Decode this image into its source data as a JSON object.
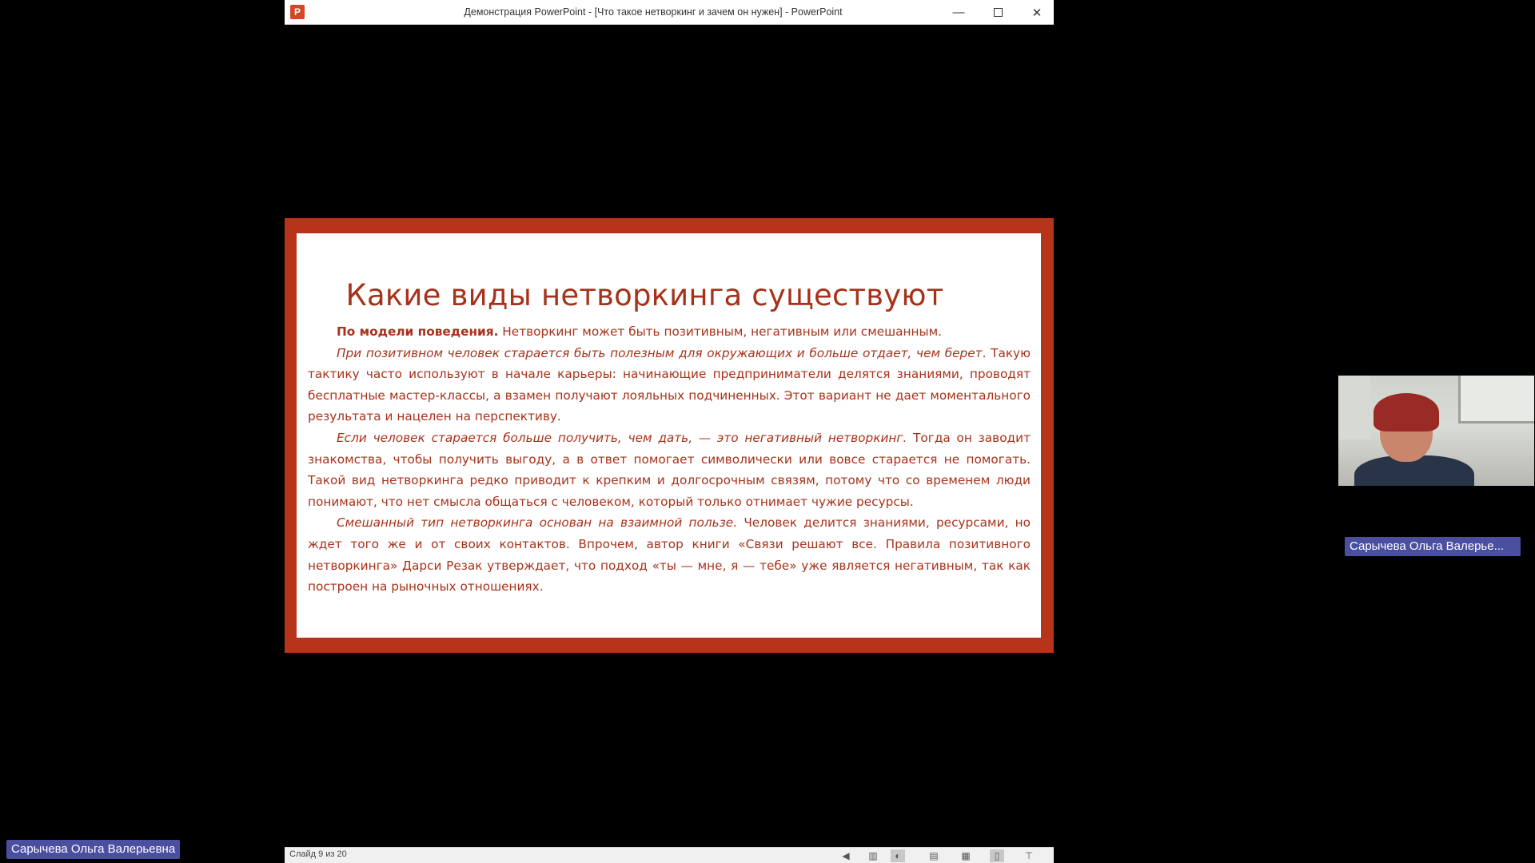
{
  "window": {
    "app_icon": "P",
    "title": "Демонстрация PowerPoint - [Что такое нетворкинг и зачем он нужен] - PowerPoint",
    "min_glyph": "—",
    "close_glyph": "✕"
  },
  "slide": {
    "title": "Какие виды нетворкинга существуют",
    "p1_bold": "По модели поведения.",
    "p1_text": " Нетворкинг может быть позитивным, негативным или смешанным.",
    "p2_italic": "При позитивном человек старается быть полезным для окружающих и больше отдает, чем берет",
    "p2_text": ". Такую тактику часто используют в начале карьеры: начинающие предприниматели делятся знаниями, проводят бесплатные мастер-классы, а взамен получают лояльных подчиненных. Этот вариант не дает моментального результата и нацелен на перспективу.",
    "p3_italic": "Если человек старается больше получить, чем дать, — это негативный нетворкинг.",
    "p3_text": " Тогда он заводит знакомства, чтобы получить выгоду, а в ответ помогает символически или вовсе старается не помогать. Такой вид нетворкинга редко приводит к крепким и долгосрочным связям, потому что со временем люди понимают, что нет смысла общаться с человеком, который только отнимает чужие ресурсы.",
    "p4_italic": "Смешанный тип нетворкинга основан на взаимной пользе.",
    "p4_text": " Человек делится знаниями, ресурсами, но ждет того же и от своих контактов. Впрочем, автор книги «Связи решают все. Правила позитивного нетворкинга» Дарси Резак утверждает, что подход «ты — мне, я — тебе» уже является негативным, так как построен на рыночных отношениях."
  },
  "statusbar": {
    "slide_counter": "Слайд 9 из 20",
    "icons": [
      "back-icon",
      "notes-icon",
      "pointer-icon",
      "normal-view-icon",
      "slide-sorter-icon",
      "reading-view-icon",
      "slideshow-icon"
    ]
  },
  "participants": {
    "self_name": "Сарычева Ольга Валерьевна",
    "remote_name": "Сарычева Ольга Валерье..."
  },
  "colors": {
    "slide_border": "#b5341a",
    "slide_text": "#a7321a",
    "name_tag": "#4b4f9f"
  }
}
